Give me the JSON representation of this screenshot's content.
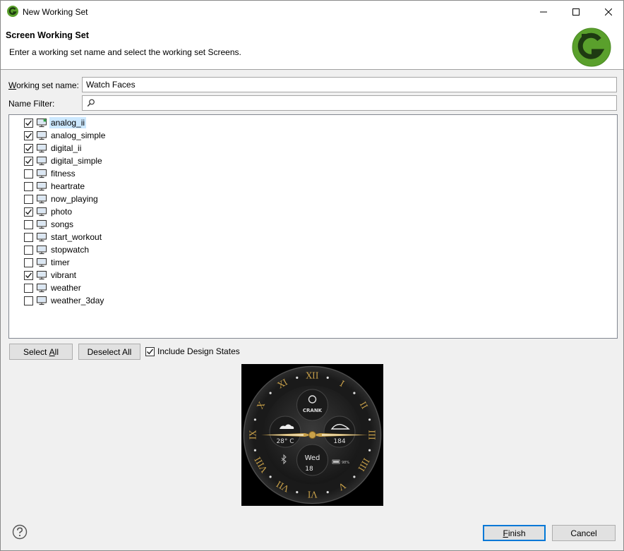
{
  "window": {
    "title": "New Working Set",
    "controls": {
      "minimize": "—",
      "maximize": "☐",
      "close": "✕"
    }
  },
  "header": {
    "title": "Screen Working Set",
    "description": "Enter a working set name and select the working set Screens."
  },
  "form": {
    "name_label_prefix": "W",
    "name_label_rest": "orking set name:",
    "name_value": "Watch Faces",
    "filter_label": "Name Filter:",
    "filter_value": ""
  },
  "screens": [
    {
      "label": "analog_ii",
      "checked": true,
      "selected": true,
      "starred": true
    },
    {
      "label": "analog_simple",
      "checked": true
    },
    {
      "label": "digital_ii",
      "checked": true
    },
    {
      "label": "digital_simple",
      "checked": true
    },
    {
      "label": "fitness",
      "checked": false
    },
    {
      "label": "heartrate",
      "checked": false
    },
    {
      "label": "now_playing",
      "checked": false
    },
    {
      "label": "photo",
      "checked": true
    },
    {
      "label": "songs",
      "checked": false
    },
    {
      "label": "start_workout",
      "checked": false
    },
    {
      "label": "stopwatch",
      "checked": false
    },
    {
      "label": "timer",
      "checked": false
    },
    {
      "label": "vibrant",
      "checked": true
    },
    {
      "label": "weather",
      "checked": false
    },
    {
      "label": "weather_3day",
      "checked": false
    }
  ],
  "buttons": {
    "select_all_prefix": "Select ",
    "select_all_mnemonic": "A",
    "select_all_rest": "ll",
    "deselect_all_prefix": "Deselect All",
    "include_design_states": "Include Design States",
    "include_design_states_checked": true,
    "finish_mnemonic": "F",
    "finish_rest": "inish",
    "cancel": "Cancel"
  },
  "preview": {
    "brand": "CRANK",
    "weather_temp": "28° C",
    "steps": "184",
    "day": "Wed",
    "date": "18",
    "battery": "98%",
    "numerals": [
      "XII",
      "I",
      "II",
      "III",
      "IIII",
      "V",
      "VI",
      "VII",
      "VIII",
      "IX",
      "X",
      "XI"
    ]
  },
  "colors": {
    "accent": "#0078d7",
    "selection": "#cce8ff",
    "logo_green": "#5aa02c",
    "gold": "#c9a14a"
  },
  "icons": {
    "app": "crank-logo-icon",
    "screen": "monitor-icon",
    "search": "search-icon",
    "help": "help-icon"
  }
}
